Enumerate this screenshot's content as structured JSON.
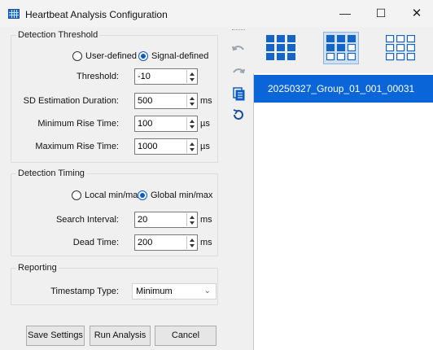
{
  "window": {
    "title": "Heartbeat Analysis Configuration",
    "minimize": "—",
    "maximize": "☐",
    "close": "✕"
  },
  "detection_threshold": {
    "title": "Detection Threshold",
    "radio_user": "User-defined",
    "radio_signal": "Signal-defined",
    "selected": "signal",
    "threshold_label": "Threshold:",
    "threshold_value": "-10",
    "sd_label": "SD Estimation Duration:",
    "sd_value": "500",
    "sd_unit": "ms",
    "min_rise_label": "Minimum Rise Time:",
    "min_rise_value": "100",
    "min_rise_unit": "µs",
    "max_rise_label": "Maximum Rise Time:",
    "max_rise_value": "1000",
    "max_rise_unit": "µs"
  },
  "detection_timing": {
    "title": "Detection Timing",
    "radio_local": "Local min/max",
    "radio_global": "Global min/max",
    "selected": "global",
    "search_label": "Search Interval:",
    "search_value": "20",
    "search_unit": "ms",
    "dead_label": "Dead Time:",
    "dead_value": "200",
    "dead_unit": "ms"
  },
  "reporting": {
    "title": "Reporting",
    "timestamp_label": "Timestamp Type:",
    "timestamp_value": "Minimum"
  },
  "buttons": {
    "save": "Save Settings",
    "run": "Run Analysis",
    "cancel": "Cancel"
  },
  "toolbar_icons": [
    "undo-arrow-icon",
    "redo-arrow-icon",
    "copy-icon",
    "refresh-icon"
  ],
  "layout_icons": [
    "grid-3x3-filled-icon",
    "grid-3x3-mixed-icon",
    "grid-3x3-outline-icon"
  ],
  "file_list": [
    "20250327_Group_01_001_00031"
  ],
  "colors": {
    "accent": "#0a66d8",
    "radio_checked": "#0a5cc4"
  }
}
